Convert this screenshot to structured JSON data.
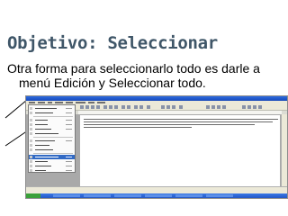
{
  "slide": {
    "title": "Objetivo: Seleccionar",
    "body_line1": "Otra forma para seleccionarlo todo es darle a",
    "body_line2": "menú Edición y Seleccionar todo."
  },
  "colors": {
    "title": "#3f5668",
    "selection_highlight": "#316ac5",
    "taskbar": "#2458c6"
  },
  "screenshot": {
    "window_title_icon": "word-icon",
    "start_button_icon": "windows-start-icon"
  }
}
